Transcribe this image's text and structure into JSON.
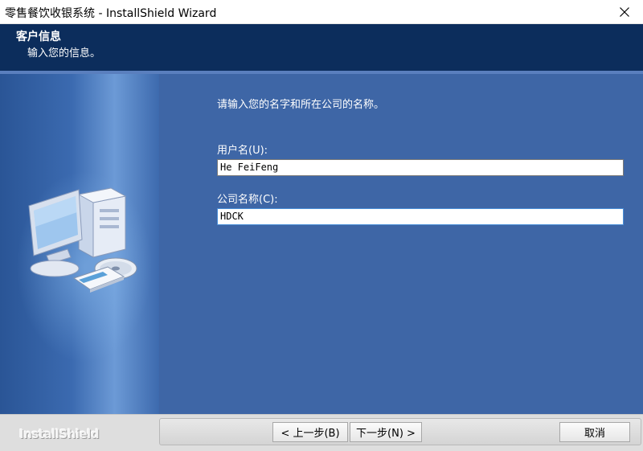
{
  "window": {
    "title": "零售餐饮收银系统 - InstallShield Wizard",
    "close_icon": "close-icon"
  },
  "header": {
    "title": "客户信息",
    "subtitle": "输入您的信息。"
  },
  "main": {
    "prompt": "请输入您的名字和所在公司的名称。",
    "user_label": "用户名(U):",
    "user_value": "He FeiFeng",
    "company_label": "公司名称(C):",
    "company_value": "HDCK"
  },
  "footer": {
    "brand": "InstallShield",
    "back_label": "< 上一步(B)",
    "next_label": "下一步(N) >",
    "cancel_label": "取消"
  },
  "colors": {
    "header_bg": "#0c2d5c",
    "body_bg": "#3e66a6",
    "footer_bg": "#dedede"
  }
}
